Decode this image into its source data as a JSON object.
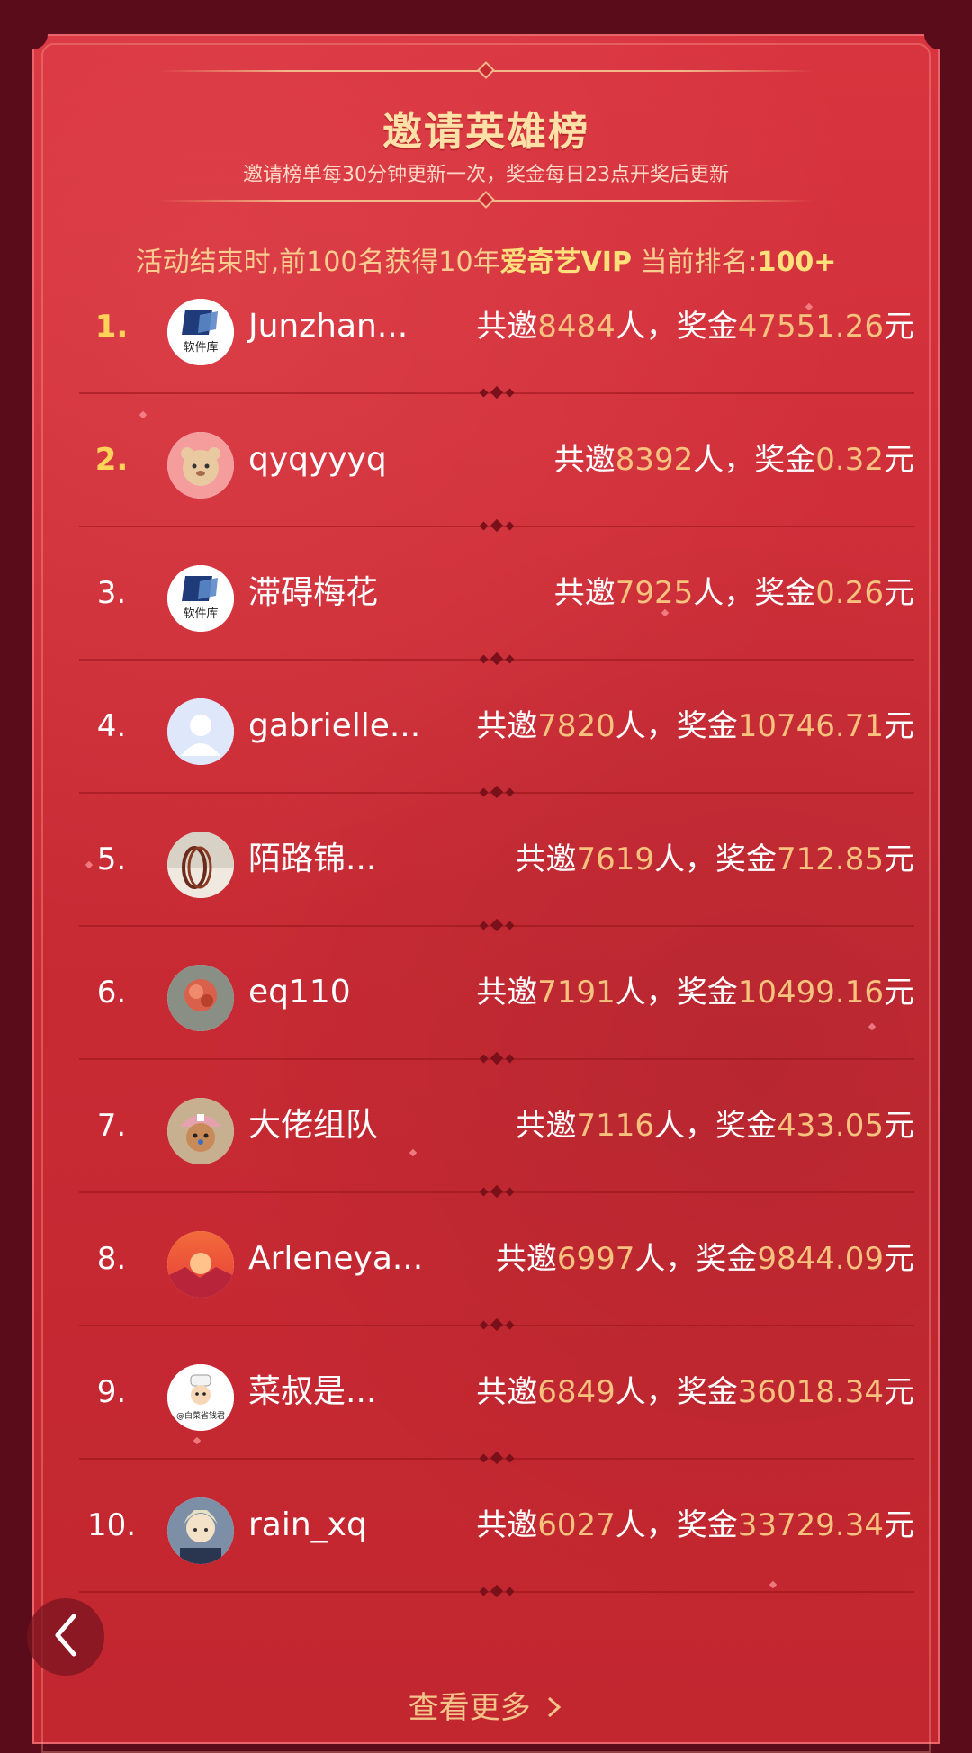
{
  "header": {
    "title": "邀请英雄榜",
    "subtitle": "邀请榜单每30分钟更新一次，奖金每日23点开奖后更新"
  },
  "notice": {
    "prefix": "活动结束时,前100名获得10年",
    "brand": "爱奇艺VIP",
    "middle": " 当前排名:",
    "rank": "100+"
  },
  "list": [
    {
      "rank": "1.",
      "name": "Junzhan...",
      "pre": "共邀",
      "count": "8484",
      "mid": "人，奖金",
      "amount": "47551.26",
      "unit": "元",
      "avatar": "software-library-logo"
    },
    {
      "rank": "2.",
      "name": "qyqyyyq",
      "pre": "共邀",
      "count": "8392",
      "mid": "人，奖金",
      "amount": "0.32",
      "unit": "元",
      "avatar": "cartoon-bear"
    },
    {
      "rank": "3.",
      "name": "滞碍梅花",
      "pre": "共邀",
      "count": "7925",
      "mid": "人，奖金",
      "amount": "0.26",
      "unit": "元",
      "avatar": "software-library-logo"
    },
    {
      "rank": "4.",
      "name": "gabrielle...",
      "pre": "共邀",
      "count": "7820",
      "mid": "人，奖金",
      "amount": "10746.71",
      "unit": "元",
      "avatar": "default-user"
    },
    {
      "rank": "5.",
      "name": "陌路锦...",
      "pre": "共邀",
      "count": "7619",
      "mid": "人，奖金",
      "amount": "712.85",
      "unit": "元",
      "avatar": "bracelet-photo"
    },
    {
      "rank": "6.",
      "name": "eq110",
      "pre": "共邀",
      "count": "7191",
      "mid": "人，奖金",
      "amount": "10499.16",
      "unit": "元",
      "avatar": "red-flower-photo"
    },
    {
      "rank": "7.",
      "name": "大佬组队",
      "pre": "共邀",
      "count": "7116",
      "mid": "人，奖金",
      "amount": "433.05",
      "unit": "元",
      "avatar": "chopper-plush"
    },
    {
      "rank": "8.",
      "name": "Arleneya...",
      "pre": "共邀",
      "count": "6997",
      "mid": "人，奖金",
      "amount": "9844.09",
      "unit": "元",
      "avatar": "sunset"
    },
    {
      "rank": "9.",
      "name": "菜叔是...",
      "pre": "共邀",
      "count": "6849",
      "mid": "人，奖金",
      "amount": "36018.34",
      "unit": "元",
      "avatar": "cartoon-chef",
      "avatar_text": "@白菜省钱君"
    },
    {
      "rank": "10.",
      "name": "rain_xq",
      "pre": "共邀",
      "count": "6027",
      "mid": "人，奖金",
      "amount": "33729.34",
      "unit": "元",
      "avatar": "anime-character"
    }
  ],
  "logo_text": "软件库",
  "footer": {
    "more_label": "查看更多",
    "more_icon": "chevron-right-icon"
  },
  "nav": {
    "back_icon": "chevron-left-icon"
  },
  "colors": {
    "background": "#5a0c1a",
    "card": "#c92b35",
    "highlight": "#f7c27d",
    "gold_rank": "#ffd35a",
    "title": "#ffe0a6"
  }
}
